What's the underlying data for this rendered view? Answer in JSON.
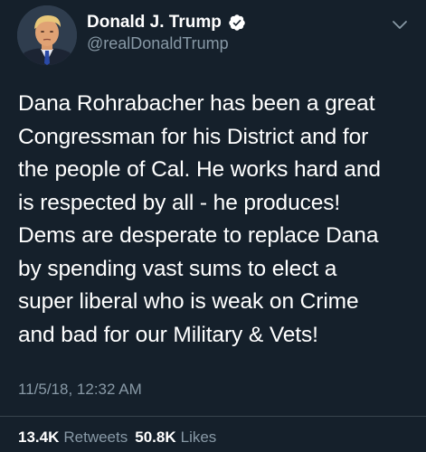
{
  "header": {
    "display_name": "Donald J. Trump",
    "handle": "@realDonaldTrump",
    "verified_icon": "verified-badge-icon",
    "more_icon": "chevron-down-icon"
  },
  "tweet": {
    "text": "Dana Rohrabacher has been a great\nCongressman for his District and for\nthe people of Cal. He works hard and\nis respected by all - he produces!\nDems are desperate to replace Dana\nby spending vast sums to elect a\nsuper liberal who is weak on Crime\nand bad for our Military & Vets!",
    "timestamp": "11/5/18, 12:32 AM"
  },
  "stats": {
    "retweets_count": "13.4K",
    "retweets_label": "Retweets",
    "likes_count": "50.8K",
    "likes_label": "Likes"
  },
  "colors": {
    "background": "#15202b",
    "secondary_text": "#8899a6",
    "verified_blue": "#1da1f2",
    "divider": "#38444d"
  }
}
